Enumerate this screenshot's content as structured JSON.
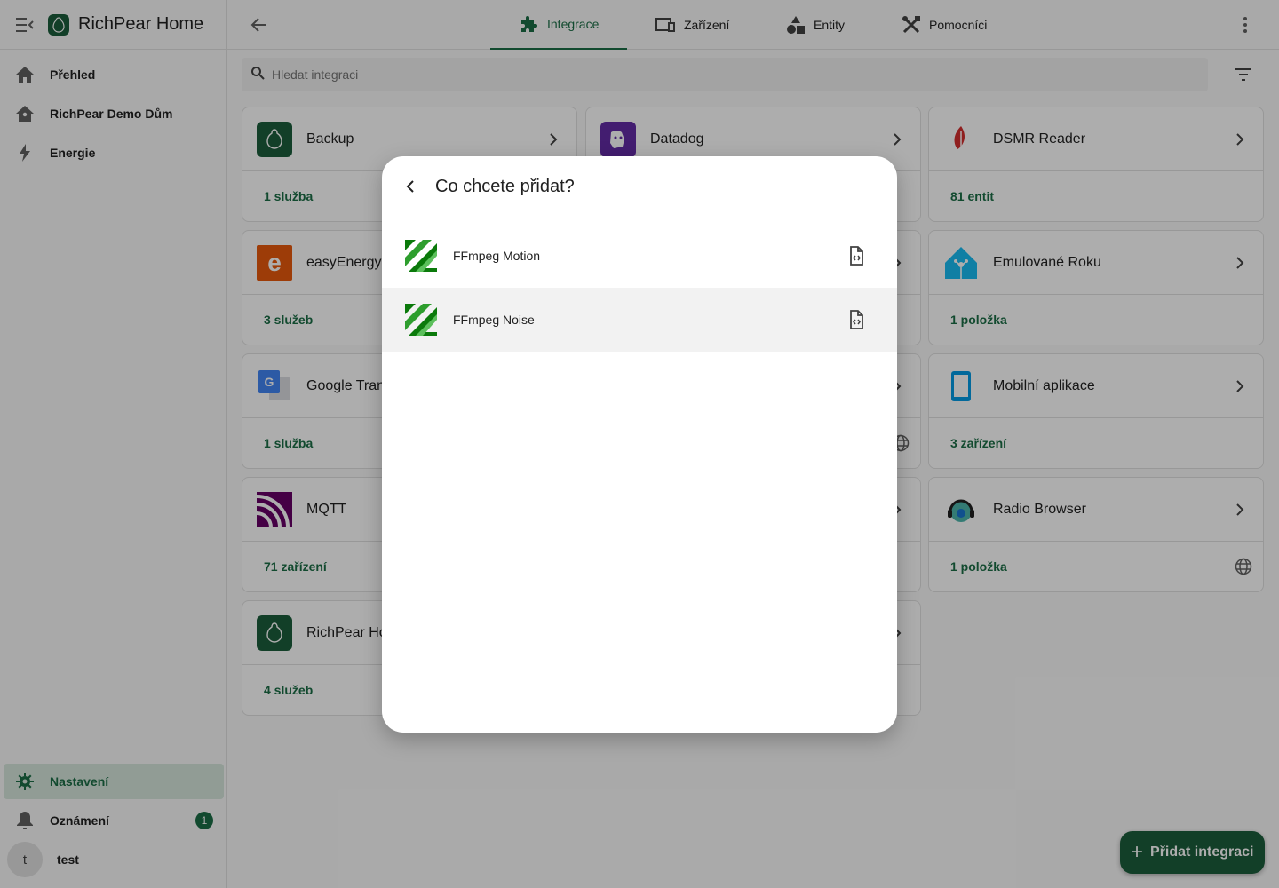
{
  "app": {
    "title": "RichPear Home"
  },
  "sidebar": {
    "items": [
      {
        "label": "Přehled",
        "icon": "home-icon"
      },
      {
        "label": "RichPear Demo Dům",
        "icon": "home-account-icon"
      },
      {
        "label": "Energie",
        "icon": "lightning-icon"
      }
    ],
    "bottom": {
      "settings": "Nastavení",
      "notifications": "Oznámení",
      "notifications_count": "1",
      "user_initial": "t",
      "user_name": "test"
    }
  },
  "topbar": {
    "tabs": [
      {
        "label": "Integrace",
        "icon": "puzzle-icon",
        "active": true
      },
      {
        "label": "Zařízení",
        "icon": "devices-icon",
        "active": false
      },
      {
        "label": "Entity",
        "icon": "shapes-icon",
        "active": false
      },
      {
        "label": "Pomocníci",
        "icon": "tools-icon",
        "active": false
      }
    ]
  },
  "search": {
    "placeholder": "Hledat integraci"
  },
  "cards": [
    {
      "name": "Backup",
      "footer": "1 služba"
    },
    {
      "name": "Datadog",
      "footer": ""
    },
    {
      "name": "DSMR Reader",
      "footer": "81 entit"
    },
    {
      "name": "easyEnergy",
      "footer": "3 služeb"
    },
    {
      "name": "Emulované Roku",
      "footer": "1 položka"
    },
    {
      "name": "Google Tran",
      "footer": "1 služba"
    },
    {
      "name": "Mobilní aplikace",
      "footer": "3 zařízení"
    },
    {
      "name": "MQTT",
      "footer": "71 zařízení"
    },
    {
      "name": "Radio Browser",
      "footer": "1 položka"
    },
    {
      "name": "RichPear Ho",
      "footer": "4 služeb"
    }
  ],
  "dialog": {
    "title": "Co chcete přidat?",
    "items": [
      {
        "name": "FFmpeg Motion",
        "icon": "ffmpeg-logo",
        "action_icon": "file-code-icon"
      },
      {
        "name": "FFmpeg Noise",
        "icon": "ffmpeg-logo",
        "action_icon": "file-code-icon"
      }
    ]
  },
  "fab": {
    "label": "Přidat integraci"
  },
  "colors": {
    "accent": "#1b6e46",
    "fab": "#1b5e3b",
    "scrim": "rgba(0,0,0,0.32)"
  }
}
